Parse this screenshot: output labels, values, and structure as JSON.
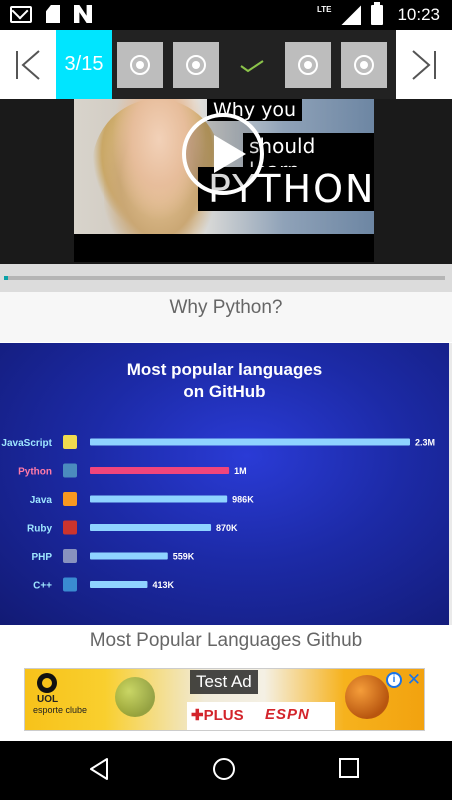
{
  "status_bar": {
    "network": "LTE",
    "time": "10:23",
    "icons": [
      "gmail-icon",
      "sd-card-icon",
      "n-app-icon",
      "signal-icon",
      "battery-charging-icon"
    ]
  },
  "lesson_nav": {
    "counter": "3/15",
    "prev_icon": "skip-previous-icon",
    "next_icon": "skip-next-icon",
    "step_icons": [
      "radio-icon",
      "radio-icon",
      "check-icon",
      "radio-icon",
      "radio-icon"
    ],
    "accent_color": "#00e5ff"
  },
  "video": {
    "thumb_line1": "Why you",
    "thumb_line2": "should learn",
    "thumb_line3": "PYTHON",
    "progress_fraction": 0.01,
    "progress_color": "#0aa2a8"
  },
  "captions": {
    "first": "Why Python?",
    "second": "Most Popular Languages Github"
  },
  "slide": {
    "title_line1": "Most popular languages",
    "title_line2": "on GitHub"
  },
  "chart_data": {
    "type": "bar",
    "orientation": "horizontal",
    "title": "Most popular languages on GitHub",
    "categories": [
      "JavaScript",
      "Python",
      "Java",
      "Ruby",
      "PHP",
      "C++"
    ],
    "values": [
      2300000,
      1000000,
      986000,
      870000,
      559000,
      413000
    ],
    "value_labels": [
      "2.3M",
      "1M",
      "986K",
      "870K",
      "559K",
      "413K"
    ],
    "icons": [
      "js-icon",
      "python-icon",
      "java-icon",
      "ruby-icon",
      "php-icon",
      "cpp-icon"
    ],
    "highlight": "Python",
    "highlight_color": "#f0457c",
    "bar_color": "#8fd3ff",
    "xlim": [
      0,
      2300000
    ],
    "grid": false,
    "legend": "none"
  },
  "ad": {
    "label": "Test Ad",
    "brand_top": "UOL",
    "brand_bottom": "esporte clube",
    "partner1": "PLUS",
    "partner2": "ESPN",
    "info_icon": "i",
    "close_icon": "✕"
  },
  "android_nav": {
    "icons": [
      "back-icon",
      "home-icon",
      "recents-icon"
    ]
  }
}
